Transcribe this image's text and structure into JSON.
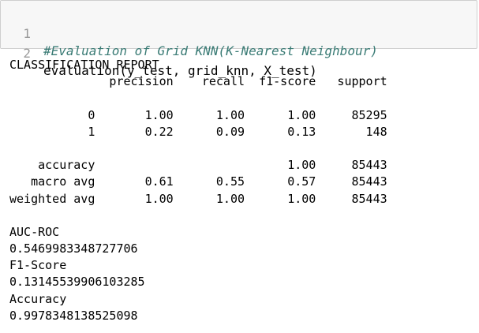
{
  "code_cell": {
    "lines": [
      {
        "number": "1",
        "text": "#Evaluation of Grid KNN(K-Nearest Neighbour)",
        "is_comment": true
      },
      {
        "number": "2",
        "text": "evaluation(y_test, grid_knn, X_test)",
        "is_comment": false
      }
    ]
  },
  "output": {
    "heading": "CLASSIFICATION REPORT",
    "report_header": "              precision    recall  f1-score   support",
    "report_rows": [
      "",
      "           0       1.00      1.00      1.00     85295",
      "           1       0.22      0.09      0.13       148",
      "",
      "    accuracy                           1.00     85443",
      "   macro avg       0.61      0.55      0.57     85443",
      "weighted avg       1.00      1.00      1.00     85443",
      ""
    ],
    "metrics": [
      {
        "label": "AUC-ROC",
        "value": "0.5469983348727706"
      },
      {
        "label": "F1-Score",
        "value": "0.13145539906103285"
      },
      {
        "label": "Accuracy",
        "value": "0.9978348138525098"
      }
    ]
  }
}
